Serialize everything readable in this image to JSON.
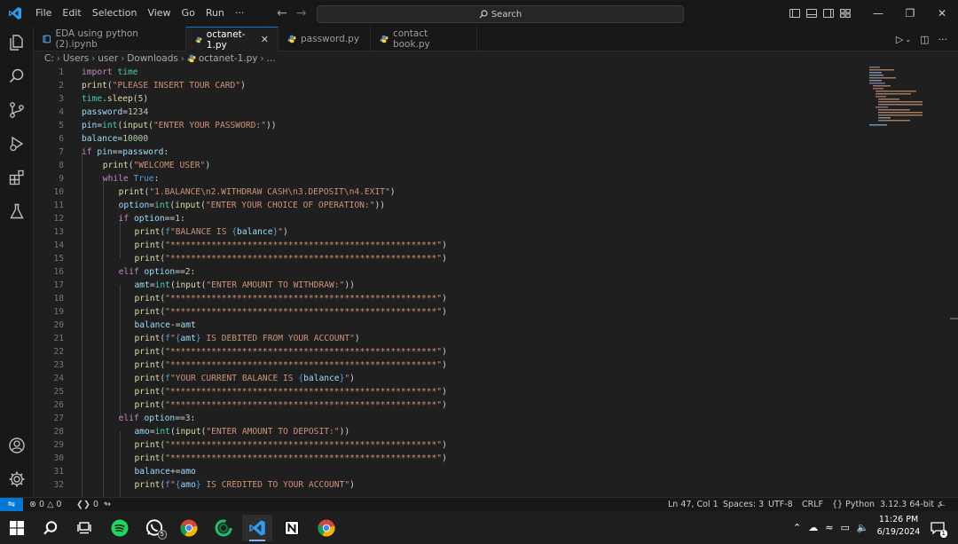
{
  "menu": [
    "File",
    "Edit",
    "Selection",
    "View",
    "Go",
    "Run",
    "···"
  ],
  "search": {
    "label": "Search"
  },
  "tabs": [
    {
      "label": "EDA using python (2).ipynb",
      "active": false
    },
    {
      "label": "octanet-1.py",
      "active": true
    },
    {
      "label": "password.py",
      "active": false
    },
    {
      "label": "contact book.py",
      "active": false
    }
  ],
  "breadcrumb": [
    "C:",
    "Users",
    "user",
    "Downloads",
    "octanet-1.py",
    "..."
  ],
  "code": {
    "lines": [
      {
        "num": "1",
        "tokens": [
          {
            "t": "import",
            "c": "k"
          },
          {
            "t": " "
          },
          {
            "t": "time",
            "c": "m"
          }
        ]
      },
      {
        "num": "2",
        "tokens": [
          {
            "t": "print",
            "c": "f"
          },
          {
            "t": "(",
            "c": "o"
          },
          {
            "t": "\"PLEASE INSERT TOUR CARD\"",
            "c": "s"
          },
          {
            "t": ")",
            "c": "o"
          }
        ]
      },
      {
        "num": "3",
        "tokens": [
          {
            "t": "time",
            "c": "m"
          },
          {
            "t": ".",
            "c": "o"
          },
          {
            "t": "sleep",
            "c": "f"
          },
          {
            "t": "(",
            "c": "o"
          },
          {
            "t": "5",
            "c": "n"
          },
          {
            "t": ")",
            "c": "o"
          }
        ]
      },
      {
        "num": "4",
        "tokens": [
          {
            "t": "password",
            "c": "v"
          },
          {
            "t": "=",
            "c": "o"
          },
          {
            "t": "1234",
            "c": "n"
          }
        ]
      },
      {
        "num": "5",
        "tokens": [
          {
            "t": "pin",
            "c": "v"
          },
          {
            "t": "=",
            "c": "o"
          },
          {
            "t": "int",
            "c": "m"
          },
          {
            "t": "(",
            "c": "o"
          },
          {
            "t": "input",
            "c": "f"
          },
          {
            "t": "(",
            "c": "o"
          },
          {
            "t": "\"ENTER YOUR PASSWORD:\"",
            "c": "s"
          },
          {
            "t": "))",
            "c": "o"
          }
        ]
      },
      {
        "num": "6",
        "tokens": [
          {
            "t": "balance",
            "c": "v"
          },
          {
            "t": "=",
            "c": "o"
          },
          {
            "t": "10000",
            "c": "n"
          }
        ]
      },
      {
        "num": "7",
        "tokens": [
          {
            "t": "if",
            "c": "k"
          },
          {
            "t": " "
          },
          {
            "t": "pin",
            "c": "v"
          },
          {
            "t": "==",
            "c": "o"
          },
          {
            "t": "password",
            "c": "v"
          },
          {
            "t": ":",
            "c": "o"
          }
        ]
      },
      {
        "num": "8",
        "indent": 4,
        "tokens": [
          {
            "t": "print",
            "c": "f"
          },
          {
            "t": "(",
            "c": "o"
          },
          {
            "t": "\"WELCOME USER\"",
            "c": "s"
          },
          {
            "t": ")",
            "c": "o"
          }
        ]
      },
      {
        "num": "9",
        "indent": 4,
        "tokens": [
          {
            "t": "while",
            "c": "k"
          },
          {
            "t": " "
          },
          {
            "t": "True",
            "c": "kb"
          },
          {
            "t": ":",
            "c": "o"
          }
        ]
      },
      {
        "num": "10",
        "indent": 7,
        "tokens": [
          {
            "t": "print",
            "c": "f"
          },
          {
            "t": "(",
            "c": "o"
          },
          {
            "t": "\"1.BALANCE\\n2.WITHDRAW CASH\\n3.DEPOSIT\\n4.EXIT\"",
            "c": "s"
          },
          {
            "t": ")",
            "c": "o"
          }
        ]
      },
      {
        "num": "11",
        "indent": 7,
        "tokens": [
          {
            "t": "option",
            "c": "v"
          },
          {
            "t": "=",
            "c": "o"
          },
          {
            "t": "int",
            "c": "m"
          },
          {
            "t": "(",
            "c": "o"
          },
          {
            "t": "input",
            "c": "f"
          },
          {
            "t": "(",
            "c": "o"
          },
          {
            "t": "\"ENTER YOUR CHOICE OF OPERATION:\"",
            "c": "s"
          },
          {
            "t": "))",
            "c": "o"
          }
        ]
      },
      {
        "num": "12",
        "indent": 7,
        "tokens": [
          {
            "t": "if",
            "c": "k"
          },
          {
            "t": " "
          },
          {
            "t": "option",
            "c": "v"
          },
          {
            "t": "==",
            "c": "o"
          },
          {
            "t": "1",
            "c": "n"
          },
          {
            "t": ":",
            "c": "o"
          }
        ]
      },
      {
        "num": "13",
        "indent": 10,
        "tokens": [
          {
            "t": "print",
            "c": "f"
          },
          {
            "t": "(",
            "c": "o"
          },
          {
            "t": "f",
            "c": "kb"
          },
          {
            "t": "\"BALANCE IS ",
            "c": "s"
          },
          {
            "t": "{",
            "c": "kb"
          },
          {
            "t": "balance",
            "c": "v"
          },
          {
            "t": "}",
            "c": "kb"
          },
          {
            "t": "\"",
            "c": "s"
          },
          {
            "t": ")",
            "c": "o"
          }
        ]
      },
      {
        "num": "14",
        "indent": 10,
        "tokens": [
          {
            "t": "print",
            "c": "f"
          },
          {
            "t": "(",
            "c": "o"
          },
          {
            "t": "\"****************************************************\"",
            "c": "s"
          },
          {
            "t": ")",
            "c": "o"
          }
        ]
      },
      {
        "num": "15",
        "indent": 10,
        "tokens": [
          {
            "t": "print",
            "c": "f"
          },
          {
            "t": "(",
            "c": "o"
          },
          {
            "t": "\"****************************************************\"",
            "c": "s"
          },
          {
            "t": ")",
            "c": "o"
          }
        ]
      },
      {
        "num": "16",
        "indent": 7,
        "tokens": [
          {
            "t": "elif",
            "c": "k"
          },
          {
            "t": " "
          },
          {
            "t": "option",
            "c": "v"
          },
          {
            "t": "==",
            "c": "o"
          },
          {
            "t": "2",
            "c": "n"
          },
          {
            "t": ":",
            "c": "o"
          }
        ]
      },
      {
        "num": "17",
        "indent": 10,
        "tokens": [
          {
            "t": "amt",
            "c": "v"
          },
          {
            "t": "=",
            "c": "o"
          },
          {
            "t": "int",
            "c": "m"
          },
          {
            "t": "(",
            "c": "o"
          },
          {
            "t": "input",
            "c": "f"
          },
          {
            "t": "(",
            "c": "o"
          },
          {
            "t": "\"ENTER AMOUNT TO WITHDRAW:\"",
            "c": "s"
          },
          {
            "t": "))",
            "c": "o"
          }
        ]
      },
      {
        "num": "18",
        "indent": 10,
        "tokens": [
          {
            "t": "print",
            "c": "f"
          },
          {
            "t": "(",
            "c": "o"
          },
          {
            "t": "\"****************************************************\"",
            "c": "s"
          },
          {
            "t": ")",
            "c": "o"
          }
        ]
      },
      {
        "num": "19",
        "indent": 10,
        "tokens": [
          {
            "t": "print",
            "c": "f"
          },
          {
            "t": "(",
            "c": "o"
          },
          {
            "t": "\"****************************************************\"",
            "c": "s"
          },
          {
            "t": ")",
            "c": "o"
          }
        ]
      },
      {
        "num": "20",
        "indent": 10,
        "tokens": [
          {
            "t": "balance",
            "c": "v"
          },
          {
            "t": "-=",
            "c": "o"
          },
          {
            "t": "amt",
            "c": "v"
          }
        ]
      },
      {
        "num": "21",
        "indent": 10,
        "tokens": [
          {
            "t": "print",
            "c": "f"
          },
          {
            "t": "(",
            "c": "o"
          },
          {
            "t": "f",
            "c": "kb"
          },
          {
            "t": "\"",
            "c": "s"
          },
          {
            "t": "{",
            "c": "kb"
          },
          {
            "t": "amt",
            "c": "v"
          },
          {
            "t": "}",
            "c": "kb"
          },
          {
            "t": " IS DEBITED FROM YOUR ACCOUNT\"",
            "c": "s"
          },
          {
            "t": ")",
            "c": "o"
          }
        ]
      },
      {
        "num": "22",
        "indent": 10,
        "tokens": [
          {
            "t": "print",
            "c": "f"
          },
          {
            "t": "(",
            "c": "o"
          },
          {
            "t": "\"****************************************************\"",
            "c": "s"
          },
          {
            "t": ")",
            "c": "o"
          }
        ]
      },
      {
        "num": "23",
        "indent": 10,
        "tokens": [
          {
            "t": "print",
            "c": "f"
          },
          {
            "t": "(",
            "c": "o"
          },
          {
            "t": "\"****************************************************\"",
            "c": "s"
          },
          {
            "t": ")",
            "c": "o"
          }
        ]
      },
      {
        "num": "24",
        "indent": 10,
        "tokens": [
          {
            "t": "print",
            "c": "f"
          },
          {
            "t": "(",
            "c": "o"
          },
          {
            "t": "f",
            "c": "kb"
          },
          {
            "t": "\"YOUR CURRENT BALANCE IS ",
            "c": "s"
          },
          {
            "t": "{",
            "c": "kb"
          },
          {
            "t": "balance",
            "c": "v"
          },
          {
            "t": "}",
            "c": "kb"
          },
          {
            "t": "\"",
            "c": "s"
          },
          {
            "t": ")",
            "c": "o"
          }
        ]
      },
      {
        "num": "25",
        "indent": 10,
        "tokens": [
          {
            "t": "print",
            "c": "f"
          },
          {
            "t": "(",
            "c": "o"
          },
          {
            "t": "\"****************************************************\"",
            "c": "s"
          },
          {
            "t": ")",
            "c": "o"
          }
        ]
      },
      {
        "num": "26",
        "indent": 10,
        "tokens": [
          {
            "t": "print",
            "c": "f"
          },
          {
            "t": "(",
            "c": "o"
          },
          {
            "t": "\"****************************************************\"",
            "c": "s"
          },
          {
            "t": ")",
            "c": "o"
          }
        ]
      },
      {
        "num": "27",
        "indent": 7,
        "tokens": [
          {
            "t": "elif",
            "c": "k"
          },
          {
            "t": " "
          },
          {
            "t": "option",
            "c": "v"
          },
          {
            "t": "==",
            "c": "o"
          },
          {
            "t": "3",
            "c": "n"
          },
          {
            "t": ":",
            "c": "o"
          }
        ]
      },
      {
        "num": "28",
        "indent": 10,
        "tokens": [
          {
            "t": "amo",
            "c": "v"
          },
          {
            "t": "=",
            "c": "o"
          },
          {
            "t": "int",
            "c": "m"
          },
          {
            "t": "(",
            "c": "o"
          },
          {
            "t": "input",
            "c": "f"
          },
          {
            "t": "(",
            "c": "o"
          },
          {
            "t": "\"ENTER AMOUNT TO DEPOSIT:\"",
            "c": "s"
          },
          {
            "t": "))",
            "c": "o"
          }
        ]
      },
      {
        "num": "29",
        "indent": 10,
        "tokens": [
          {
            "t": "print",
            "c": "f"
          },
          {
            "t": "(",
            "c": "o"
          },
          {
            "t": "\"****************************************************\"",
            "c": "s"
          },
          {
            "t": ")",
            "c": "o"
          }
        ]
      },
      {
        "num": "30",
        "indent": 10,
        "tokens": [
          {
            "t": "print",
            "c": "f"
          },
          {
            "t": "(",
            "c": "o"
          },
          {
            "t": "\"****************************************************\"",
            "c": "s"
          },
          {
            "t": ")",
            "c": "o"
          }
        ]
      },
      {
        "num": "31",
        "indent": 10,
        "tokens": [
          {
            "t": "balance",
            "c": "v"
          },
          {
            "t": "+=",
            "c": "o"
          },
          {
            "t": "amo",
            "c": "v"
          }
        ]
      },
      {
        "num": "32",
        "indent": 10,
        "tokens": [
          {
            "t": "print",
            "c": "f"
          },
          {
            "t": "(",
            "c": "o"
          },
          {
            "t": "f",
            "c": "kb"
          },
          {
            "t": "\"",
            "c": "s"
          },
          {
            "t": "{",
            "c": "kb"
          },
          {
            "t": "amo",
            "c": "v"
          },
          {
            "t": "}",
            "c": "kb"
          },
          {
            "t": " IS CREDITED TO YOUR ACCOUNT\"",
            "c": "s"
          },
          {
            "t": ")",
            "c": "o"
          }
        ]
      }
    ]
  },
  "status": {
    "errors": "0",
    "warnings": "0",
    "ports": "0",
    "cursor": "Ln 47, Col 1",
    "spaces": "Spaces: 3",
    "encoding": "UTF-8",
    "eol": "CRLF",
    "language": "Python",
    "interpreter": "3.12.3 64-bit"
  },
  "taskbar": {
    "time": "11:26 PM",
    "date": "6/19/2024",
    "whatsapp_badge": "5",
    "notification_badge": "1"
  },
  "colors": {
    "accent": "#0078d4",
    "editor_bg": "#1f1f1f",
    "chrome_bg": "#181818"
  }
}
